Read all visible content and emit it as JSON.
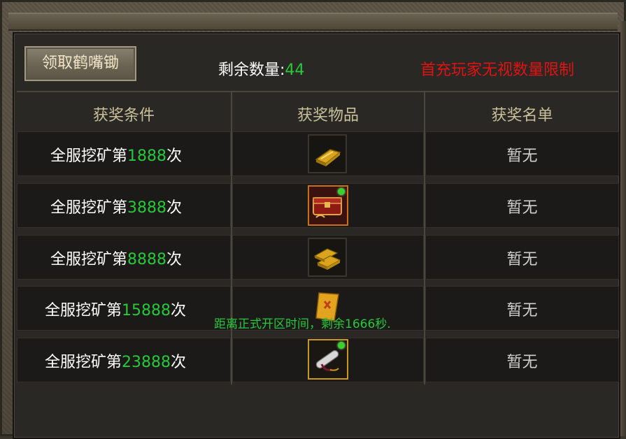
{
  "claim_button": "领取鹤嘴锄",
  "remaining": {
    "label": "剩余数量:",
    "value": "44"
  },
  "notice": "首充玩家无视数量限制",
  "headers": {
    "condition": "获奖条件",
    "item": "获奖物品",
    "winners": "获奖名单"
  },
  "rows": [
    {
      "prefix": "全服挖矿第",
      "count": "1888",
      "suffix": "次",
      "winners": "暂无",
      "item_icon": "gold-bar-icon"
    },
    {
      "prefix": "全服挖矿第",
      "count": "3888",
      "suffix": "次",
      "winners": "暂无",
      "item_icon": "red-chest-icon"
    },
    {
      "prefix": "全服挖矿第",
      "count": "8888",
      "suffix": "次",
      "winners": "暂无",
      "item_icon": "gold-bars-stack-icon"
    },
    {
      "prefix": "全服挖矿第",
      "count": "15888",
      "suffix": "次",
      "winners": "暂无",
      "item_icon": "gold-scroll-icon"
    },
    {
      "prefix": "全服挖矿第",
      "count": "23888",
      "suffix": "次",
      "winners": "暂无",
      "item_icon": "rolled-scroll-icon"
    }
  ],
  "server_message": "距离正式开区时间，剩余1666秒.",
  "colors": {
    "highlight_green": "#27c83a",
    "notice_red": "#e01313",
    "header_gold": "#c9c09a"
  }
}
